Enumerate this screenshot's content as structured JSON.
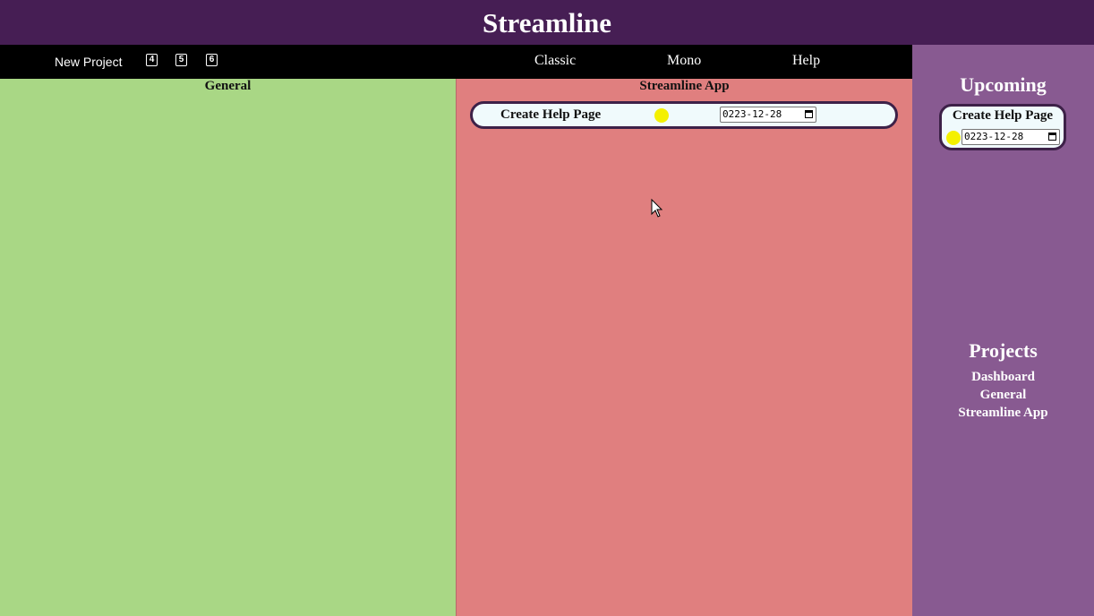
{
  "app": {
    "title": "Streamline"
  },
  "toolbar": {
    "new_project_label": "New Project",
    "keys": [
      "4",
      "5",
      "6"
    ],
    "themes": [
      "Classic",
      "Mono"
    ],
    "help_label": "Help"
  },
  "columns": [
    {
      "title": "General",
      "color": "#a9d785",
      "tasks": []
    },
    {
      "title": "Streamline App",
      "color": "#e07f7f",
      "tasks": [
        {
          "name": "Create Help Page",
          "priority_color": "#f4f000",
          "due": "0223-12-28"
        }
      ]
    }
  ],
  "sidebar": {
    "upcoming_title": "Upcoming",
    "upcoming": [
      {
        "name": "Create Help Page",
        "priority_color": "#f4f000",
        "due": "0223-12-28"
      }
    ],
    "projects_title": "Projects",
    "projects": [
      "Dashboard",
      "General",
      "Streamline App"
    ]
  },
  "colors": {
    "header": "#461e54",
    "navbar": "#000000",
    "sidebar": "#885a91",
    "card_border": "#3d2148"
  }
}
